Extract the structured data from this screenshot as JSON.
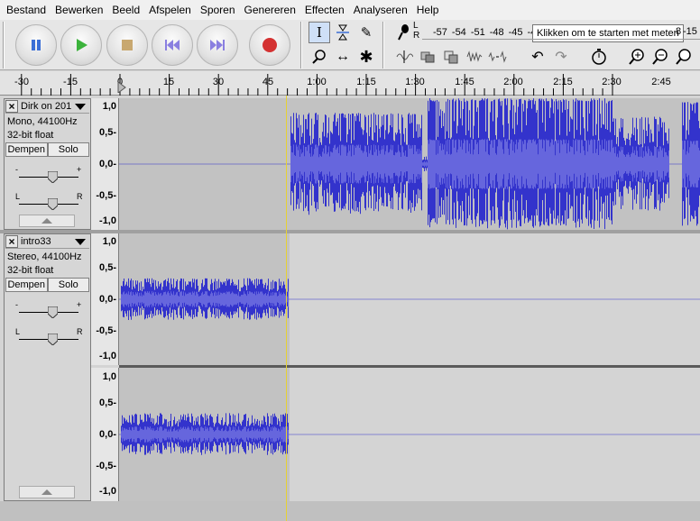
{
  "menu": [
    "Bestand",
    "Bewerken",
    "Beeld",
    "Afspelen",
    "Sporen",
    "Genereren",
    "Effecten",
    "Analyseren",
    "Help"
  ],
  "transport": {
    "pause": "pause-icon",
    "play": "play-icon",
    "stop": "stop-icon",
    "skip_start": "skip-to-start-icon",
    "skip_end": "skip-to-end-icon",
    "record": "record-icon"
  },
  "tools_row1": [
    "selection-icon",
    "envelope-icon",
    "draw-icon"
  ],
  "tools_row2": [
    "zoom-icon",
    "timeshift-icon",
    "multi-tool-icon"
  ],
  "meter": {
    "rec_labels": [
      "L",
      "R"
    ],
    "scale": [
      "-57",
      "-54",
      "-51",
      "-48",
      "-45",
      "-4"
    ],
    "tooltip": "Klikken om te starten met meten",
    "right_fragment": "8",
    "right_fragment2": "-15"
  },
  "edit_tools": [
    "trim-icon",
    "silence-icon",
    "copy-icon",
    "paste-icon",
    "undo-icon",
    "redo-icon",
    "sync-lock-icon",
    "zoom-in-icon",
    "zoom-out-icon",
    "fit-selection-icon"
  ],
  "ruler": {
    "labels": [
      "-30",
      "-15",
      "0",
      "15",
      "30",
      "45",
      "1:00",
      "1:15",
      "1:30",
      "1:45",
      "2:00",
      "2:15",
      "2:30",
      "2:45"
    ]
  },
  "tracks": [
    {
      "name": "Dirk on 201",
      "info1": "Mono, 44100Hz",
      "info2": "32-bit float",
      "mute": "Dempen",
      "solo": "Solo",
      "gain_minus": "-",
      "gain_plus": "+",
      "pan_l": "L",
      "pan_r": "R",
      "scale": [
        "1,0",
        "0,5-",
        "0,0-",
        "-0,5-",
        "-1,0"
      ]
    },
    {
      "name": "intro33",
      "info1": "Stereo, 44100Hz",
      "info2": "32-bit float",
      "mute": "Dempen",
      "solo": "Solo",
      "gain_minus": "-",
      "gain_plus": "+",
      "pan_l": "L",
      "pan_r": "R",
      "scale": [
        "1,0",
        "0,5-",
        "0,0-",
        "-0,5-",
        "-1,0"
      ],
      "scale2": [
        "1,0",
        "0,5-",
        "0,0-",
        "-0,5-",
        "-1,0"
      ]
    }
  ],
  "colors": {
    "waveform": "#3333cc",
    "waveform_rms": "#6666dd",
    "selected_bg": "#c0c0c0",
    "track_bg": "#d4d4d4",
    "cursor": "#e6d233"
  }
}
